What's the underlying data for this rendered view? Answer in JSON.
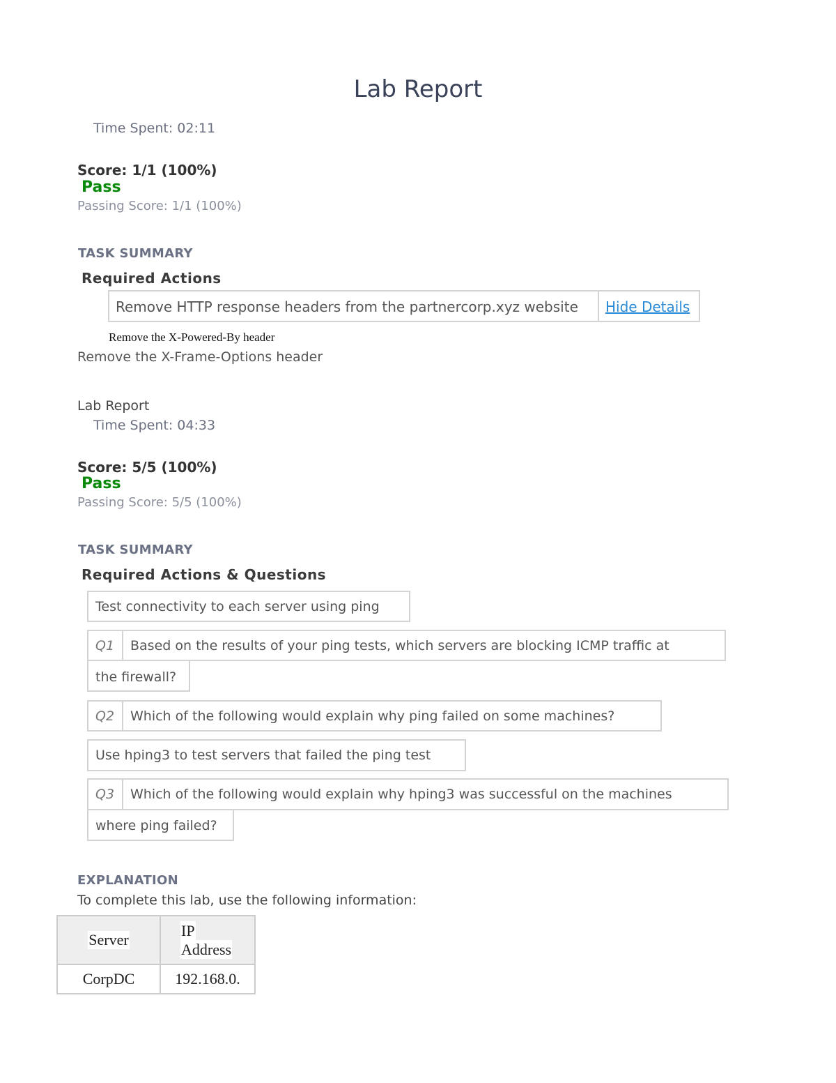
{
  "report1": {
    "title": "Lab Report",
    "time_spent": "Time Spent: 02:11",
    "score": "Score: 1/1 (100%)",
    "result": "Pass",
    "passing_score": "Passing Score: 1/1 (100%)",
    "task_summary_label": "TASK SUMMARY",
    "required_label": "Required Actions",
    "actions": [
      {
        "text": "Remove HTTP response headers from the partnercorp.xyz website",
        "toggle_label": "Hide Details",
        "details": [
          "Remove the X-Powered-By header",
          "Remove the X-Frame-Options header"
        ]
      }
    ]
  },
  "report2": {
    "title": "Lab Report",
    "time_spent": "Time Spent: 04:33",
    "score": "Score: 5/5 (100%)",
    "result": "Pass",
    "passing_score": "Passing Score: 5/5 (100%)",
    "task_summary_label": "TASK SUMMARY",
    "required_label": "Required Actions & Questions",
    "items": [
      {
        "type": "action",
        "text": "Test connectivity to each server using ping"
      },
      {
        "type": "question",
        "label": "Q1",
        "text_line1": "Based on the results of your ping tests, which servers are blocking ICMP traffic at",
        "text_line2": "the firewall?"
      },
      {
        "type": "question",
        "label": "Q2",
        "text_line1": "Which of the following would explain why ping failed on some machines?"
      },
      {
        "type": "action",
        "text": "Use hping3 to test servers that failed the ping test"
      },
      {
        "type": "question",
        "label": "Q3",
        "text_line1": "Which of the following would explain why hping3 was successful on the machines",
        "text_line2": "where ping failed?"
      }
    ],
    "explanation_label": "EXPLANATION",
    "explanation_text": "To complete this lab, use the following information:",
    "table": {
      "headers": [
        "Server",
        "IP",
        "Address"
      ],
      "rows": [
        [
          "CorpDC",
          "192.168.0."
        ]
      ]
    }
  },
  "colors": {
    "pass": "#0a8a0a",
    "link": "#2a8ad6",
    "title": "#3a4259",
    "section": "#6b7184",
    "border": "#d3d3d3"
  }
}
